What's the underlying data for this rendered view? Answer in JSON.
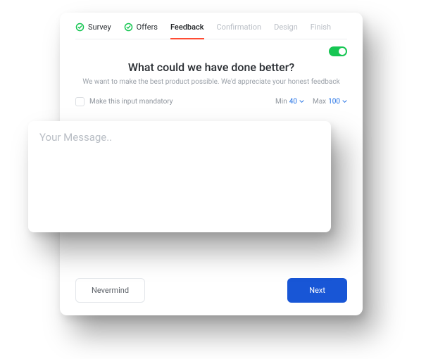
{
  "tabs": {
    "survey": "Survey",
    "offers": "Offers",
    "feedback": "Feedback",
    "confirmation": "Confirmation",
    "design": "Design",
    "finish": "Finish"
  },
  "heading": "What could we have done better?",
  "subheading": "We want to make the best product possible. We'd appreciate your honest feedback",
  "mandatory_label": "Make this input mandatory",
  "min_label": "Min",
  "min_value": "40",
  "max_label": "Max",
  "max_value": "100",
  "message_placeholder": "Your Message..",
  "buttons": {
    "cancel": "Nevermind",
    "next": "Next"
  },
  "colors": {
    "accent_red": "#ff4b33",
    "accent_green": "#17c653",
    "primary_blue": "#1856d6",
    "link_blue": "#1f6fe5"
  }
}
